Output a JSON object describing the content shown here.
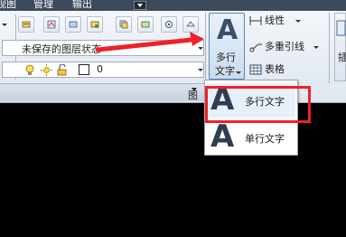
{
  "menubar": {
    "tabs": [
      "视图",
      "管理",
      "输出"
    ]
  },
  "layers_panel": {
    "layer_state": "未保存的图层状态",
    "current_layer": "0",
    "title": "图层"
  },
  "annotation_panel": {
    "mtext_glyph": "A",
    "mtext_label_line1": "多行",
    "mtext_label_line2": "文字",
    "linear": "线性",
    "multileader": "多重引线",
    "table": "表格",
    "right_partial": "插"
  },
  "text_dropdown": {
    "items": [
      {
        "glyph": "A",
        "label": "多行文字"
      },
      {
        "glyph": "A",
        "label": "单行文字"
      }
    ]
  },
  "colors": {
    "highlight": "#f02028",
    "arrow": "#f02028",
    "title_bar": "#3d4a5b"
  }
}
